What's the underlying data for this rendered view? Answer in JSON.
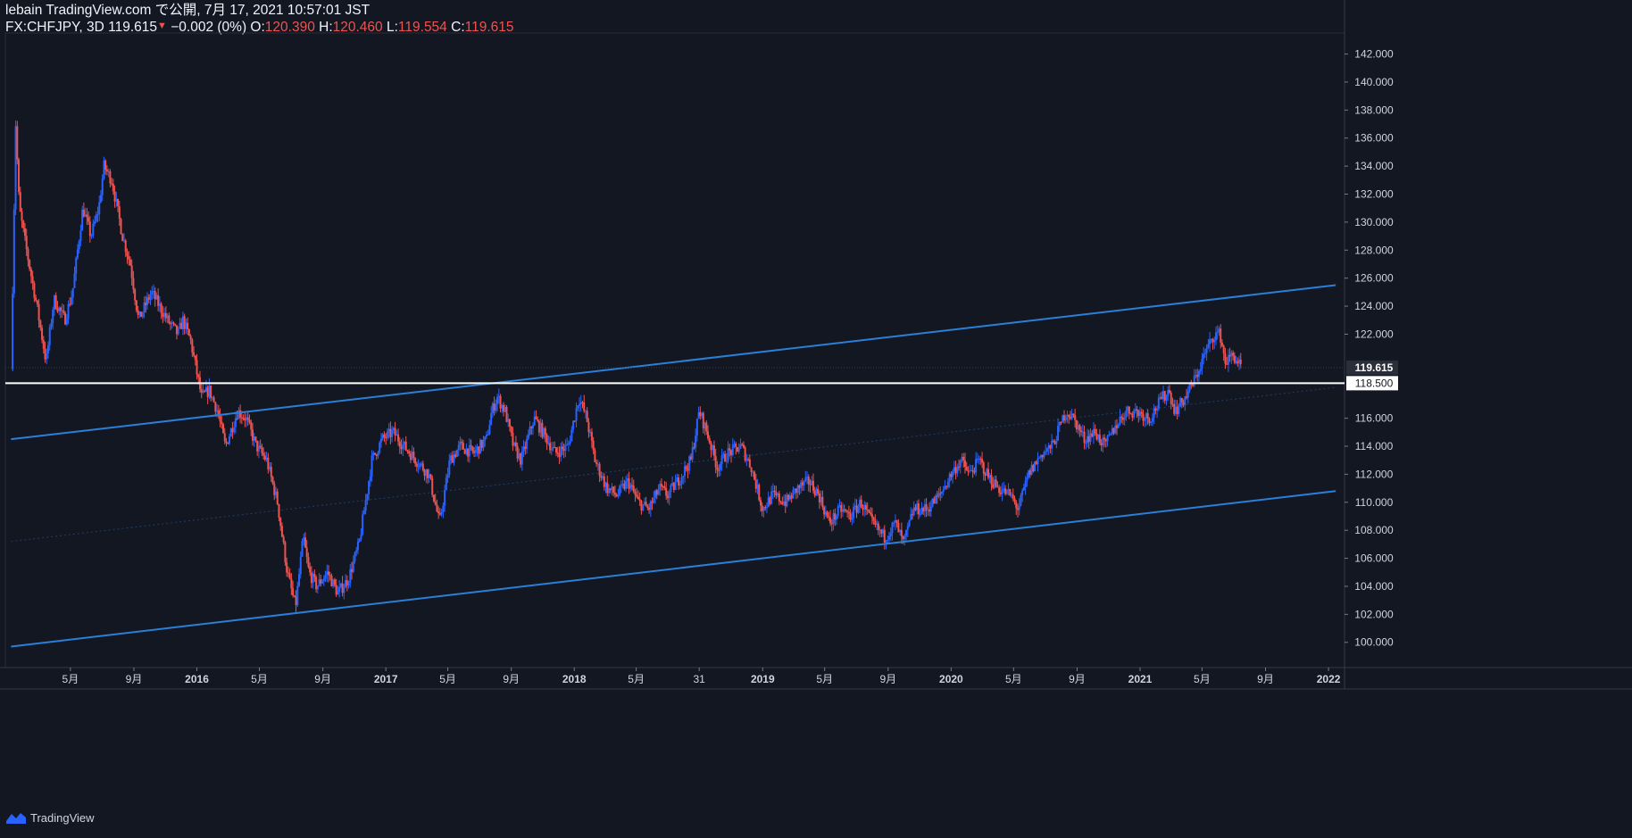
{
  "header": {
    "publish_line": "lebain TradingView.com で公開, 7月 17, 2021 10:57:01 JST",
    "symbol": "FX:CHFJPY, 3D",
    "last": "119.615",
    "change": "−0.002 (0%)",
    "o_label": "O:",
    "o_value": "120.390",
    "h_label": "H:",
    "h_value": "120.460",
    "l_label": "L:",
    "l_value": "119.554",
    "c_label": "C:",
    "c_value": "119.615"
  },
  "footer": {
    "brand": "TradingView"
  },
  "colors": {
    "background": "#131722",
    "up": "#2962ff",
    "down": "#ef5350",
    "channel": "#2a7fd8",
    "horizontal": "#ffffff",
    "grid": "#1e2230"
  },
  "chart_data": {
    "type": "candlestick",
    "symbol": "FX:CHFJPY",
    "interval": "3D",
    "x_tick_labels": [
      "5月",
      "9月",
      "2016",
      "5月",
      "9月",
      "2017",
      "5月",
      "9月",
      "2018",
      "5月",
      "31",
      "2019",
      "5月",
      "9月",
      "2020",
      "5月",
      "9月",
      "2021",
      "5月",
      "9月",
      "2022"
    ],
    "x_ticks_date": [
      "2015-05",
      "2015-09",
      "2016-01",
      "2016-05",
      "2016-09",
      "2017-01",
      "2017-05",
      "2017-09",
      "2018-01",
      "2018-05",
      "2018-08-31",
      "2019-01",
      "2019-05",
      "2019-09",
      "2020-01",
      "2020-05",
      "2020-09",
      "2021-01",
      "2021-05",
      "2021-09",
      "2022-01"
    ],
    "y_ticks": [
      "100.000",
      "102.000",
      "104.000",
      "106.000",
      "108.000",
      "110.000",
      "112.000",
      "114.000",
      "116.000",
      "118.000",
      "120.000",
      "122.000",
      "124.000",
      "126.000",
      "128.000",
      "130.000",
      "132.000",
      "134.000",
      "136.000",
      "138.000",
      "140.000",
      "142.000"
    ],
    "ylim": [
      98.2,
      143.5
    ],
    "price_path": [
      [
        "2015-01-06",
        119.5
      ],
      [
        "2015-01-15",
        137
      ],
      [
        "2015-01-22",
        131
      ],
      [
        "2015-02-05",
        128
      ],
      [
        "2015-02-25",
        124
      ],
      [
        "2015-03-15",
        120
      ],
      [
        "2015-03-30",
        124.5
      ],
      [
        "2015-04-20",
        123
      ],
      [
        "2015-05-05",
        125
      ],
      [
        "2015-05-25",
        131
      ],
      [
        "2015-06-10",
        129
      ],
      [
        "2015-06-25",
        131
      ],
      [
        "2015-07-05",
        134
      ],
      [
        "2015-07-20",
        133
      ],
      [
        "2015-08-10",
        129
      ],
      [
        "2015-08-25",
        127
      ],
      [
        "2015-09-10",
        123
      ],
      [
        "2015-10-05",
        125
      ],
      [
        "2015-11-05",
        123
      ],
      [
        "2015-11-25",
        122
      ],
      [
        "2015-12-05",
        123
      ],
      [
        "2015-12-20",
        121.5
      ],
      [
        "2016-01-10",
        117.5
      ],
      [
        "2016-01-25",
        118
      ],
      [
        "2016-02-10",
        116.5
      ],
      [
        "2016-02-25",
        114
      ],
      [
        "2016-03-20",
        116.5
      ],
      [
        "2016-04-05",
        116
      ],
      [
        "2016-04-25",
        114
      ],
      [
        "2016-05-15",
        113
      ],
      [
        "2016-06-05",
        110
      ],
      [
        "2016-06-24",
        105
      ],
      [
        "2016-07-10",
        102.5
      ],
      [
        "2016-07-25",
        107.5
      ],
      [
        "2016-08-05",
        105
      ],
      [
        "2016-08-20",
        104
      ],
      [
        "2016-09-10",
        105
      ],
      [
        "2016-09-30",
        103.5
      ],
      [
        "2016-10-20",
        104.5
      ],
      [
        "2016-11-10",
        107
      ],
      [
        "2016-12-05",
        113
      ],
      [
        "2016-12-25",
        114.5
      ],
      [
        "2017-01-15",
        115
      ],
      [
        "2017-02-05",
        114
      ],
      [
        "2017-03-01",
        113
      ],
      [
        "2017-03-25",
        112
      ],
      [
        "2017-04-15",
        108.5
      ],
      [
        "2017-05-05",
        113
      ],
      [
        "2017-05-25",
        114
      ],
      [
        "2017-06-20",
        113.5
      ],
      [
        "2017-07-15",
        114.5
      ],
      [
        "2017-07-25",
        116.5
      ],
      [
        "2017-08-05",
        117.5
      ],
      [
        "2017-08-20",
        116.5
      ],
      [
        "2017-09-05",
        114
      ],
      [
        "2017-09-20",
        113
      ],
      [
        "2017-10-15",
        116
      ],
      [
        "2017-11-01",
        115
      ],
      [
        "2017-11-25",
        113.5
      ],
      [
        "2017-12-20",
        114
      ],
      [
        "2018-01-01",
        116
      ],
      [
        "2018-01-10",
        117.5
      ],
      [
        "2018-01-25",
        116
      ],
      [
        "2018-02-10",
        113
      ],
      [
        "2018-03-05",
        111
      ],
      [
        "2018-03-25",
        110.5
      ],
      [
        "2018-04-15",
        111.5
      ],
      [
        "2018-05-05",
        110
      ],
      [
        "2018-05-25",
        109.5
      ],
      [
        "2018-06-15",
        111
      ],
      [
        "2018-07-01",
        110.5
      ],
      [
        "2018-07-20",
        111.5
      ],
      [
        "2018-08-15",
        113
      ],
      [
        "2018-08-31",
        116.5
      ],
      [
        "2018-09-15",
        115
      ],
      [
        "2018-10-05",
        112.5
      ],
      [
        "2018-10-25",
        113.5
      ],
      [
        "2018-11-20",
        114
      ],
      [
        "2018-12-10",
        112.5
      ],
      [
        "2019-01-01",
        109.5
      ],
      [
        "2019-01-20",
        110.5
      ],
      [
        "2019-02-15",
        110
      ],
      [
        "2019-03-10",
        111
      ],
      [
        "2019-04-01",
        111.5
      ],
      [
        "2019-04-20",
        110.5
      ],
      [
        "2019-05-10",
        108.5
      ],
      [
        "2019-06-01",
        109.5
      ],
      [
        "2019-06-20",
        109
      ],
      [
        "2019-07-10",
        110
      ],
      [
        "2019-08-01",
        108.5
      ],
      [
        "2019-08-25",
        107.5
      ],
      [
        "2019-09-15",
        108.5
      ],
      [
        "2019-10-01",
        107
      ],
      [
        "2019-10-20",
        109.5
      ],
      [
        "2019-11-15",
        109.5
      ],
      [
        "2019-12-10",
        110.5
      ],
      [
        "2020-01-01",
        112
      ],
      [
        "2020-01-20",
        113
      ],
      [
        "2020-02-05",
        112
      ],
      [
        "2020-02-25",
        113
      ],
      [
        "2020-03-10",
        112
      ],
      [
        "2020-04-01",
        111
      ],
      [
        "2020-04-25",
        110.5
      ],
      [
        "2020-05-10",
        109.5
      ],
      [
        "2020-05-30",
        112
      ],
      [
        "2020-06-25",
        113.5
      ],
      [
        "2020-07-15",
        114
      ],
      [
        "2020-08-10",
        116.5
      ],
      [
        "2020-08-25",
        116
      ],
      [
        "2020-09-15",
        114.5
      ],
      [
        "2020-10-05",
        115
      ],
      [
        "2020-10-25",
        114
      ],
      [
        "2020-11-15",
        115.5
      ],
      [
        "2020-12-05",
        116.5
      ],
      [
        "2020-12-25",
        116.5
      ],
      [
        "2021-01-20",
        116
      ],
      [
        "2021-02-05",
        117
      ],
      [
        "2021-02-25",
        118
      ],
      [
        "2021-03-10",
        116.5
      ],
      [
        "2021-03-30",
        117.5
      ],
      [
        "2021-04-20",
        119
      ],
      [
        "2021-05-05",
        120.5
      ],
      [
        "2021-05-25",
        122
      ],
      [
        "2021-06-05",
        122
      ],
      [
        "2021-06-15",
        120
      ],
      [
        "2021-06-30",
        120.5
      ],
      [
        "2021-07-16",
        119.615
      ]
    ],
    "channel_upper": {
      "from": [
        "2015-01-06",
        114.5
      ],
      "to": [
        "2022-01-15",
        125.5
      ]
    },
    "channel_middle": {
      "from": [
        "2015-01-06",
        107.2
      ],
      "to": [
        "2022-01-15",
        118.2
      ]
    },
    "channel_lower": {
      "from": [
        "2015-01-06",
        99.7
      ],
      "to": [
        "2022-01-15",
        110.8
      ]
    },
    "horizontal_line": 118.5,
    "price_labels": {
      "last": "119.615",
      "horizontal": "118.500"
    },
    "grid": false
  }
}
